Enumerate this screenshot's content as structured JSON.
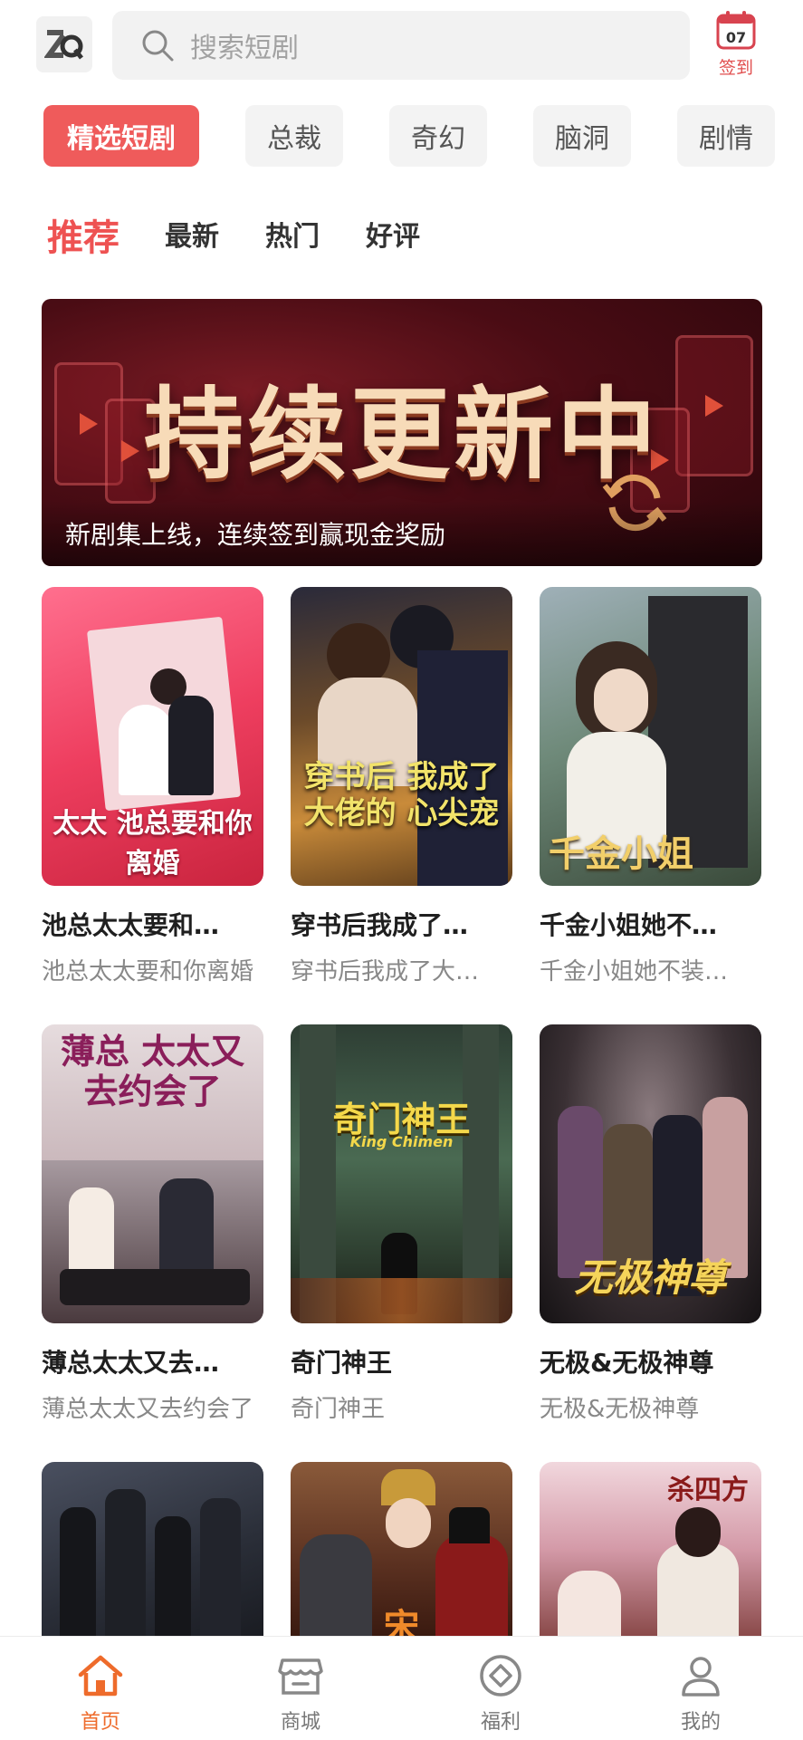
{
  "header": {
    "search_placeholder": "搜索短剧",
    "signin_day": "07",
    "signin_label": "签到"
  },
  "categories": [
    "精选短剧",
    "总裁",
    "奇幻",
    "脑洞",
    "剧情"
  ],
  "sub_tabs": [
    "推荐",
    "最新",
    "热门",
    "好评"
  ],
  "banner": {
    "title": "持续更新中",
    "caption": "新剧集上线，连续签到赢现金奖励"
  },
  "dramas": [
    {
      "title": "池总太太要和…",
      "subtitle": "池总太太要和你离婚",
      "poster_text": "太太 池总要和你离婚"
    },
    {
      "title": "穿书后我成了…",
      "subtitle": "穿书后我成了大…",
      "poster_text": "穿书后 我成了大佬的 心尖宠"
    },
    {
      "title": "千金小姐她不…",
      "subtitle": "千金小姐她不装…",
      "poster_text": "千金小姐"
    },
    {
      "title": "薄总太太又去…",
      "subtitle": "薄总太太又去约会了",
      "poster_text": "薄总 太太又 去约会了"
    },
    {
      "title": "奇门神王",
      "subtitle": "奇门神王",
      "poster_text": "奇门神王",
      "poster_sub": "King Chimen"
    },
    {
      "title": "无极&无极神尊",
      "subtitle": "无极&无极神尊",
      "poster_text": "无极神尊"
    }
  ],
  "row3_posters": [
    {
      "poster_text": ""
    },
    {
      "poster_text": "宋"
    },
    {
      "poster_text": "杀四方"
    }
  ],
  "bottom_nav": [
    {
      "label": "首页",
      "icon": "home-icon",
      "active": true
    },
    {
      "label": "商城",
      "icon": "store-icon",
      "active": false
    },
    {
      "label": "福利",
      "icon": "welfare-icon",
      "active": false
    },
    {
      "label": "我的",
      "icon": "profile-icon",
      "active": false
    }
  ],
  "colors": {
    "accent": "#ef5b5b",
    "nav_active": "#ee6b2b"
  }
}
